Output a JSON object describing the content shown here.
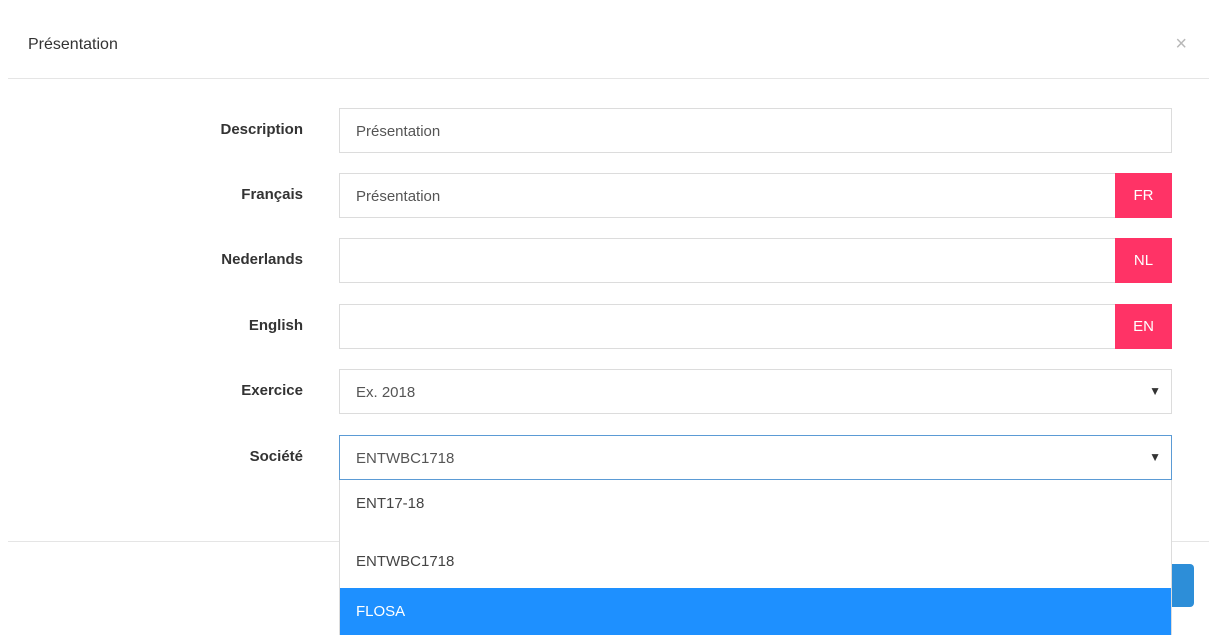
{
  "dialog": {
    "title": "Présentation",
    "close_label": "×"
  },
  "form": {
    "description": {
      "label": "Description",
      "value": "Présentation"
    },
    "francais": {
      "label": "Français",
      "value": "Présentation",
      "addon": "FR"
    },
    "nederlands": {
      "label": "Nederlands",
      "value": "",
      "addon": "NL"
    },
    "english": {
      "label": "English",
      "value": "",
      "addon": "EN"
    },
    "exercice": {
      "label": "Exercice",
      "value": "Ex. 2018",
      "caret": "▼"
    },
    "societe": {
      "label": "Société",
      "value": "ENTWBC1718",
      "caret": "▼"
    }
  },
  "dropdown": {
    "options": [
      {
        "label": "ENT17-18"
      },
      {
        "label": "ENTWBC1718"
      },
      {
        "label": "FLOSA",
        "selected": true
      }
    ]
  },
  "colors": {
    "language_addon": "#ff3366",
    "highlight": "#1e90ff",
    "primary_button": "#2d8ed8"
  }
}
